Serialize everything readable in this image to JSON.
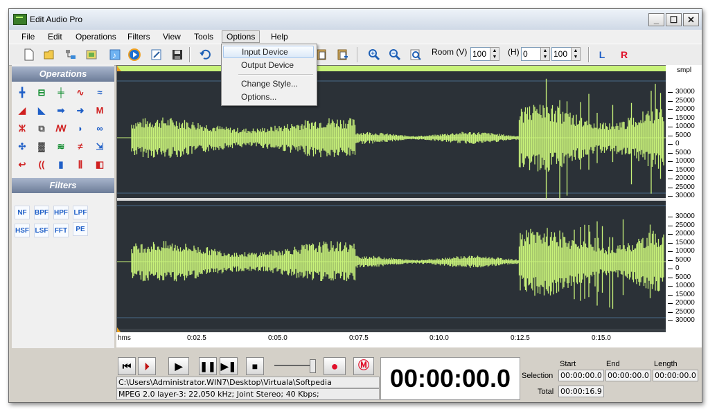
{
  "window": {
    "title": "Edit Audio Pro",
    "controls": [
      "_",
      "☐",
      "✕"
    ]
  },
  "menubar": {
    "items": [
      "File",
      "Edit",
      "Operations",
      "Filters",
      "View",
      "Tools",
      "Options",
      "Help"
    ],
    "active": "Options"
  },
  "options_menu": {
    "items": [
      "Input Device",
      "Output Device",
      "Change Style...",
      "Options..."
    ],
    "highlighted": "Input Device"
  },
  "toolbar": {
    "room_label": "Room (V)",
    "room_v_value": "100",
    "h_label": "(H)",
    "h_value": "0",
    "h_value2": "100",
    "left_channel": "L",
    "right_channel": "R"
  },
  "panels": {
    "operations_title": "Operations",
    "filters_title": "Filters"
  },
  "filters": [
    "NF",
    "BPF",
    "HPF",
    "LPF",
    "HSF",
    "LSF",
    "FFT",
    "PE"
  ],
  "amp_ruler": {
    "unit": "smpl",
    "channel1": [
      "30000",
      "25000",
      "20000",
      "15000",
      "10000",
      "5000",
      "0",
      "5000",
      "10000",
      "15000",
      "20000",
      "25000",
      "30000"
    ],
    "channel2": [
      "30000",
      "25000",
      "20000",
      "15000",
      "10000",
      "5000",
      "0",
      "5000",
      "10000",
      "15000",
      "20000",
      "25000",
      "30000"
    ]
  },
  "time_ruler": {
    "unit": "hms",
    "labels": [
      "0:02.5",
      "0:05.0",
      "0:07.5",
      "0:10.0",
      "0:12.5",
      "0:15.0"
    ]
  },
  "file_info": {
    "path": "C:\\Users\\Administrator.WIN7\\Desktop\\Virtuala\\Softpedia",
    "format": "MPEG 2.0 layer-3: 22,050 kHz; Joint Stereo; 40 Kbps;"
  },
  "time_display": "00:00:00.0",
  "selection": {
    "start_label": "Start",
    "end_label": "End",
    "length_label": "Length",
    "selection_label": "Selection",
    "total_label": "Total",
    "start": "00:00:00.0",
    "end": "00:00:00.0",
    "length": "00:00:00.0",
    "total": "00:00:16.9"
  },
  "colors": {
    "waveform": "#c8f27a",
    "wave_bg": "#2b3137",
    "accent_blue": "#1f5fc7",
    "record_red": "#e0102a"
  }
}
